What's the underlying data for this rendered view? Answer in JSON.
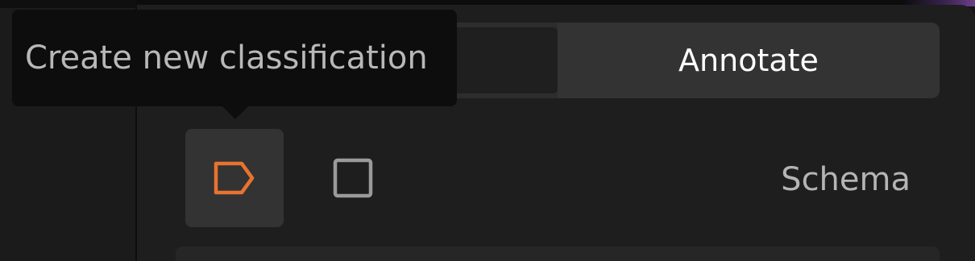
{
  "tooltip": {
    "text": "Create new classification"
  },
  "mode_toggle": {
    "active_label": "Annotate"
  },
  "tools": {
    "classification": {
      "icon": "tag-icon",
      "color": "#e8732f",
      "active": true
    },
    "box": {
      "icon": "square-icon",
      "color": "#9a9a9a"
    }
  },
  "schema": {
    "label": "Schema"
  },
  "colors": {
    "accent": "#e8732f",
    "panel": "#1e1e1e",
    "tooltip_bg": "#0d0d0d"
  }
}
